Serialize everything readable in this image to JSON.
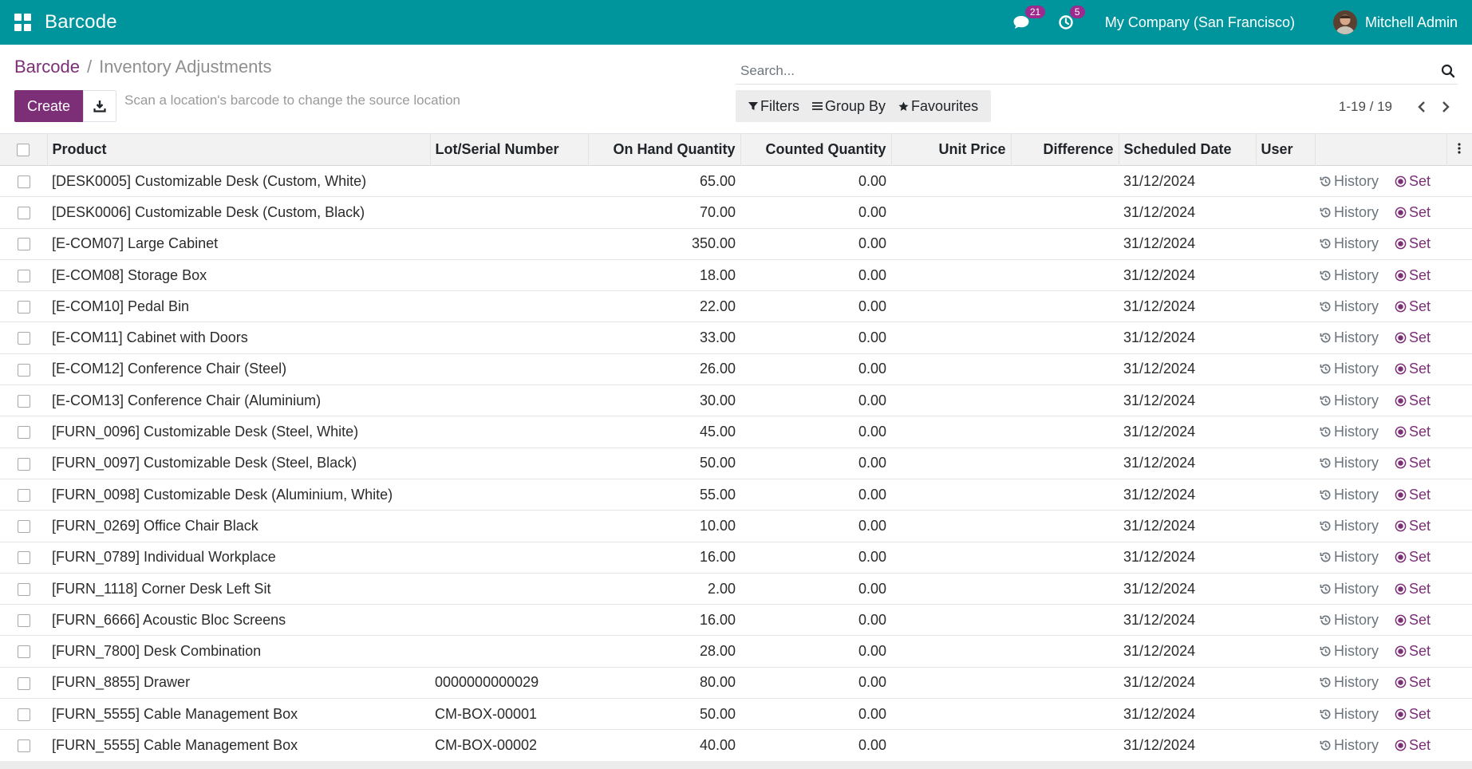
{
  "navbar": {
    "app_name": "Barcode",
    "messages_count": "21",
    "activities_count": "5",
    "company": "My Company (San Francisco)",
    "user_name": "Mitchell Admin",
    "bg_color": "#00959c"
  },
  "breadcrumb": {
    "parent": "Barcode",
    "separator": "/",
    "current": "Inventory Adjustments"
  },
  "toolbar": {
    "create_label": "Create",
    "scan_hint": "Scan a location's barcode to change the source location"
  },
  "search": {
    "placeholder": "Search..."
  },
  "filters": {
    "filters_label": "Filters",
    "group_by_label": "Group By",
    "favourites_label": "Favourites"
  },
  "pager": {
    "value": "1-19 / 19"
  },
  "table": {
    "columns": {
      "product": "Product",
      "lot": "Lot/Serial Number",
      "on_hand": "On Hand Quantity",
      "counted": "Counted Quantity",
      "unit_price": "Unit Price",
      "difference": "Difference",
      "scheduled_date": "Scheduled Date",
      "user": "User"
    },
    "history_label": "History",
    "set_label": "Set",
    "rows": [
      {
        "product": "[DESK0005] Customizable Desk (Custom, White)",
        "lot": "",
        "on_hand": "65.00",
        "counted": "0.00",
        "unit_price": "",
        "difference": "",
        "date": "31/12/2024",
        "user": ""
      },
      {
        "product": "[DESK0006] Customizable Desk (Custom, Black)",
        "lot": "",
        "on_hand": "70.00",
        "counted": "0.00",
        "unit_price": "",
        "difference": "",
        "date": "31/12/2024",
        "user": ""
      },
      {
        "product": "[E-COM07] Large Cabinet",
        "lot": "",
        "on_hand": "350.00",
        "counted": "0.00",
        "unit_price": "",
        "difference": "",
        "date": "31/12/2024",
        "user": ""
      },
      {
        "product": "[E-COM08] Storage Box",
        "lot": "",
        "on_hand": "18.00",
        "counted": "0.00",
        "unit_price": "",
        "difference": "",
        "date": "31/12/2024",
        "user": ""
      },
      {
        "product": "[E-COM10] Pedal Bin",
        "lot": "",
        "on_hand": "22.00",
        "counted": "0.00",
        "unit_price": "",
        "difference": "",
        "date": "31/12/2024",
        "user": ""
      },
      {
        "product": "[E-COM11] Cabinet with Doors",
        "lot": "",
        "on_hand": "33.00",
        "counted": "0.00",
        "unit_price": "",
        "difference": "",
        "date": "31/12/2024",
        "user": ""
      },
      {
        "product": "[E-COM12] Conference Chair (Steel)",
        "lot": "",
        "on_hand": "26.00",
        "counted": "0.00",
        "unit_price": "",
        "difference": "",
        "date": "31/12/2024",
        "user": ""
      },
      {
        "product": "[E-COM13] Conference Chair (Aluminium)",
        "lot": "",
        "on_hand": "30.00",
        "counted": "0.00",
        "unit_price": "",
        "difference": "",
        "date": "31/12/2024",
        "user": ""
      },
      {
        "product": "[FURN_0096] Customizable Desk (Steel, White)",
        "lot": "",
        "on_hand": "45.00",
        "counted": "0.00",
        "unit_price": "",
        "difference": "",
        "date": "31/12/2024",
        "user": ""
      },
      {
        "product": "[FURN_0097] Customizable Desk (Steel, Black)",
        "lot": "",
        "on_hand": "50.00",
        "counted": "0.00",
        "unit_price": "",
        "difference": "",
        "date": "31/12/2024",
        "user": ""
      },
      {
        "product": "[FURN_0098] Customizable Desk (Aluminium, White)",
        "lot": "",
        "on_hand": "55.00",
        "counted": "0.00",
        "unit_price": "",
        "difference": "",
        "date": "31/12/2024",
        "user": ""
      },
      {
        "product": "[FURN_0269] Office Chair Black",
        "lot": "",
        "on_hand": "10.00",
        "counted": "0.00",
        "unit_price": "",
        "difference": "",
        "date": "31/12/2024",
        "user": ""
      },
      {
        "product": "[FURN_0789] Individual Workplace",
        "lot": "",
        "on_hand": "16.00",
        "counted": "0.00",
        "unit_price": "",
        "difference": "",
        "date": "31/12/2024",
        "user": ""
      },
      {
        "product": "[FURN_1118] Corner Desk Left Sit",
        "lot": "",
        "on_hand": "2.00",
        "counted": "0.00",
        "unit_price": "",
        "difference": "",
        "date": "31/12/2024",
        "user": ""
      },
      {
        "product": "[FURN_6666] Acoustic Bloc Screens",
        "lot": "",
        "on_hand": "16.00",
        "counted": "0.00",
        "unit_price": "",
        "difference": "",
        "date": "31/12/2024",
        "user": ""
      },
      {
        "product": "[FURN_7800] Desk Combination",
        "lot": "",
        "on_hand": "28.00",
        "counted": "0.00",
        "unit_price": "",
        "difference": "",
        "date": "31/12/2024",
        "user": ""
      },
      {
        "product": "[FURN_8855] Drawer",
        "lot": "0000000000029",
        "on_hand": "80.00",
        "counted": "0.00",
        "unit_price": "",
        "difference": "",
        "date": "31/12/2024",
        "user": ""
      },
      {
        "product": "[FURN_5555] Cable Management Box",
        "lot": "CM-BOX-00001",
        "on_hand": "50.00",
        "counted": "0.00",
        "unit_price": "",
        "difference": "",
        "date": "31/12/2024",
        "user": ""
      },
      {
        "product": "[FURN_5555] Cable Management Box",
        "lot": "CM-BOX-00002",
        "on_hand": "40.00",
        "counted": "0.00",
        "unit_price": "",
        "difference": "",
        "date": "31/12/2024",
        "user": ""
      }
    ]
  }
}
